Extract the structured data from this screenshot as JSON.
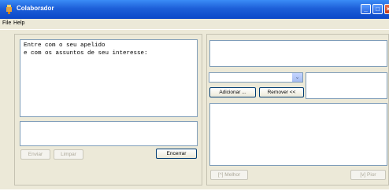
{
  "window": {
    "title": "Colaborador"
  },
  "titlebar_buttons": {
    "minimize": "_",
    "maximize": "□",
    "close": "×"
  },
  "menu": {
    "items": [
      "File",
      "Help"
    ]
  },
  "left": {
    "info_text": "Entre com o seu apelido\ne com os assuntos de seu interesse:",
    "input_value": "",
    "buttons": {
      "enviar": "Enviar",
      "limpar": "Limpar",
      "encerrar": "Encerrar"
    }
  },
  "right": {
    "combo_value": "",
    "combo_arrow": "⌄",
    "buttons": {
      "adicionar": "Adicionar ...",
      "remover": "Remover <<",
      "melhor": "[^] Melhor",
      "pior": "[v] Pior"
    }
  },
  "colors": {
    "titlebar": "#0b47c8",
    "window_bg": "#ece9d8",
    "field_border": "#7f9db9"
  }
}
